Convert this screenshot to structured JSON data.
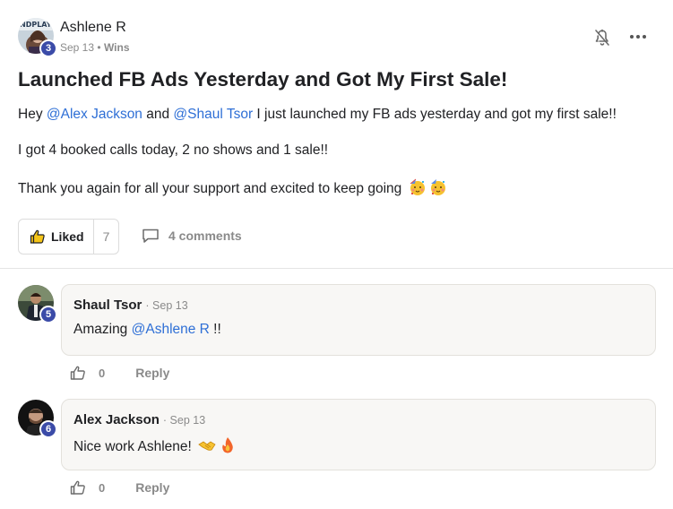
{
  "post": {
    "author": {
      "name": "Ashlene R",
      "level": "3"
    },
    "date": "Sep 13",
    "separator": "•",
    "category": "Wins",
    "title": "Launched FB Ads Yesterday and Got My First Sale!",
    "body": {
      "line1": {
        "prefix": "Hey ",
        "mention1": "@Alex Jackson",
        "middle": " and ",
        "mention2": "@Shaul Tsor",
        "suffix": " I just launched my FB ads yesterday and got my first sale!!"
      },
      "line2": "I got 4 booked calls today, 2 no shows and 1 sale!!",
      "line3": "Thank you again for all your support and excited to keep going"
    },
    "like_label": "Liked",
    "like_count": "7",
    "comments_label": "4 comments"
  },
  "comments": [
    {
      "author": "Shaul Tsor",
      "level": "5",
      "date": "· Sep 13",
      "text_prefix": "Amazing ",
      "mention": "@Ashlene R",
      "text_suffix": " !!",
      "likes": "0",
      "reply_label": "Reply"
    },
    {
      "author": "Alex Jackson",
      "level": "6",
      "date": "· Sep 13",
      "text": "Nice work Ashlene!",
      "likes": "0",
      "reply_label": "Reply"
    }
  ],
  "icons": {
    "notification": "bell-off-icon",
    "more": "more-horizontal-icon",
    "like_active": "thumbs-up-filled-icon",
    "comments": "comment-icon",
    "like": "thumbs-up-outline-icon",
    "emoji_party": "partying-face-emoji",
    "emoji_handshake": "handshake-emoji",
    "emoji_fire": "fire-emoji"
  },
  "colors": {
    "mention": "#2e6fd6",
    "level_badge": "#3b4ba8",
    "muted": "#8a8a8a",
    "comment_bg": "#f8f7f5",
    "like_fill": "#f5c518"
  }
}
